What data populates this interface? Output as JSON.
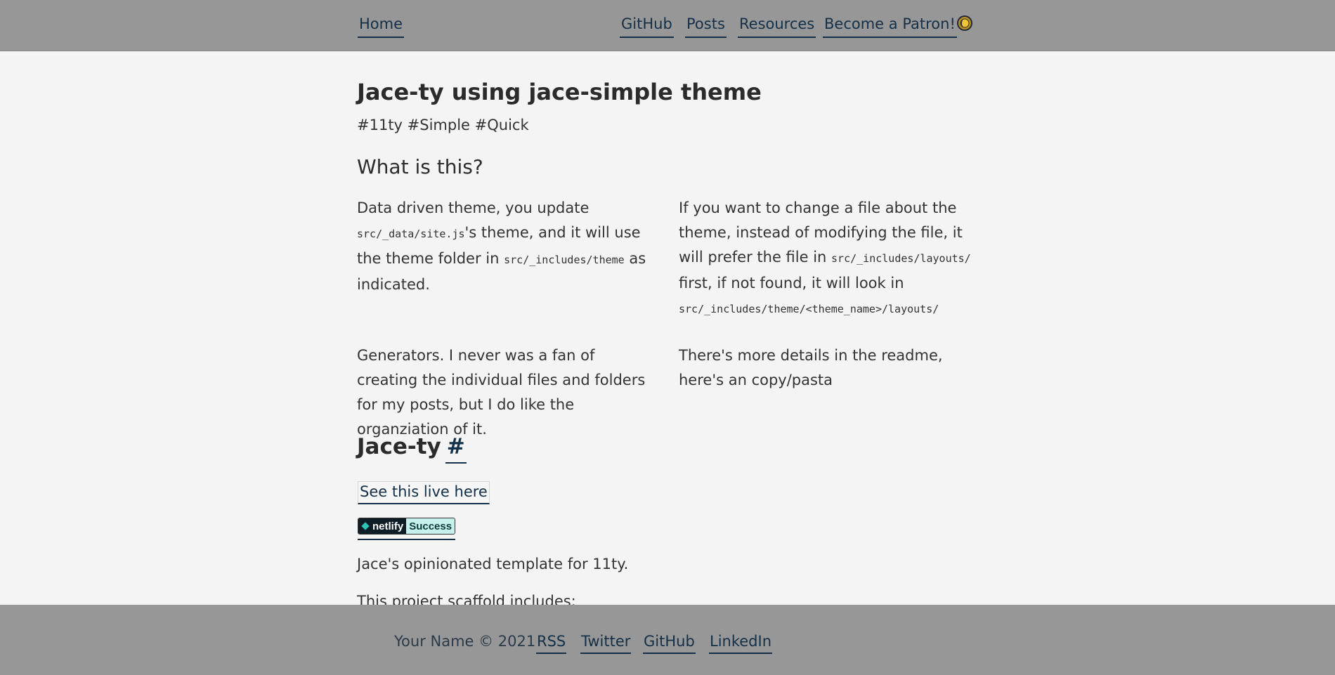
{
  "header": {
    "home_label": "Home",
    "nav": {
      "github": "GitHub",
      "posts": "Posts",
      "resources": "Resources",
      "patron": "Become a Patron!"
    },
    "theme_toggle_icon": "theme-toggle-icon"
  },
  "main": {
    "title": "Jace-ty using jace-simple theme",
    "tags": "#11ty #Simple #Quick",
    "section_heading": "What is this?",
    "para1": {
      "t1": "Data driven theme, you update ",
      "c1": "src/_data/site.js",
      "t2": "'s theme, and it will use the theme folder in ",
      "c2": "src/_includes/theme",
      "t3": " as indicated."
    },
    "para2": {
      "t1": "If you want to change a file about the theme, instead of modifying the file, it will prefer the file in ",
      "c1": "src/_includes/layouts/",
      "t2": " first, if not found, it will look in ",
      "c2": "src/_includes/theme/<theme_name>/layouts/"
    },
    "para3": "Generators. I never was a fan of creating the individual files and folders for my posts, but I do like the organziation of it.",
    "para4": "There's more details in the readme, here's an copy/pasta",
    "subheading": "Jace-ty",
    "anchor": "#",
    "live_link": "See this live here",
    "badge": {
      "left": "netlify",
      "right": "Success"
    },
    "description": "Jace's opinionated template for 11ty.",
    "scaffold_text": "This project scaffold includes:"
  },
  "footer": {
    "copyright": "Your Name © 2021",
    "links": {
      "rss": "RSS",
      "twitter": "Twitter",
      "github": "GitHub",
      "linkedin": "LinkedIn"
    }
  },
  "colors": {
    "header_bg": "#979797",
    "page_bg": "#f4f4f4",
    "link": "#143049",
    "badge_dark": "#0f1e26",
    "badge_success": "#c7f0ec"
  }
}
